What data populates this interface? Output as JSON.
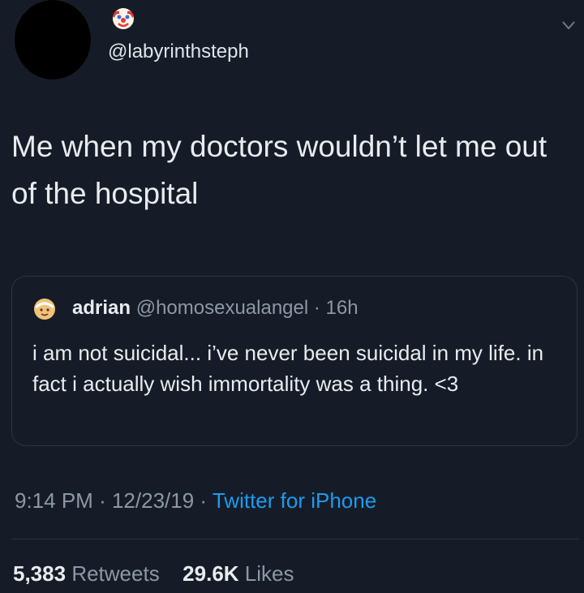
{
  "author": {
    "handle": "@labyrinthsteph",
    "name_emoji": "clown-face-icon"
  },
  "tweet": {
    "text": "Me when my doctors wouldn’t let me out of the hospital"
  },
  "quoted_tweet": {
    "name": "adrian",
    "handle": "@homosexualangel",
    "separator": "·",
    "age": "16h",
    "text": "i am not suicidal... i’ve never been suicidal in my life. in fact i actually wish immortality was a thing. <3"
  },
  "meta": {
    "time": "9:14 PM",
    "separator": "·",
    "date": "12/23/19",
    "source": "Twitter for iPhone"
  },
  "stats": {
    "retweets_count": "5,383",
    "retweets_label": "Retweets",
    "likes_count": "29.6K",
    "likes_label": "Likes"
  },
  "colors": {
    "background": "#161c27",
    "link": "#1d9bf0",
    "secondary_text": "#8b98a5"
  }
}
